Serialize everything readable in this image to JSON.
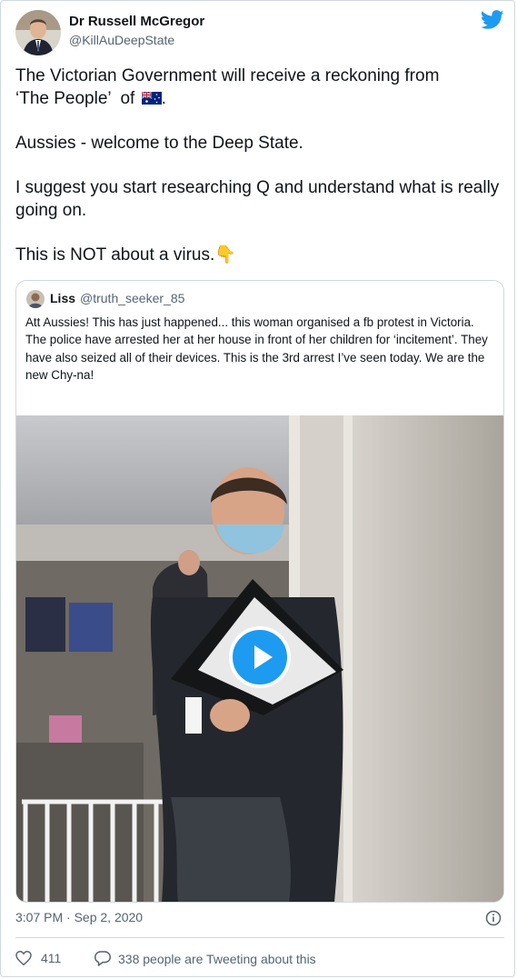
{
  "author": {
    "name": "Dr Russell McGregor",
    "handle": "@KillAuDeepState"
  },
  "tweet": {
    "line1": "The Victorian Government will receive a reckoning from",
    "line2": "‘The People’  of",
    "para2": "Aussies - welcome to the Deep State.",
    "para3": "I suggest you start researching Q and understand what is really going on.",
    "para4": "This is NOT about a virus.",
    "icons": [
      "australia-flag-icon",
      "pointing-down-icon"
    ]
  },
  "quoted": {
    "name": "Liss",
    "handle": "@truth_seeker_85",
    "text": "Att Aussies! This has just happened... this woman organised a fb protest in Victoria. The police have arrested her at her house in front of her children for ‘incitement’. They have also seized all of their devices. This is the 3rd arrest I’ve seen today. We are the new Chy-na!"
  },
  "meta": {
    "timestamp": "3:07 PM · Sep 2, 2020"
  },
  "stats": {
    "likes": "411",
    "retweet_text": "338 people are Tweeting about this"
  },
  "colors": {
    "accent": "#1d9bf0",
    "secondary_text": "#536471",
    "border": "#cfd9de"
  }
}
